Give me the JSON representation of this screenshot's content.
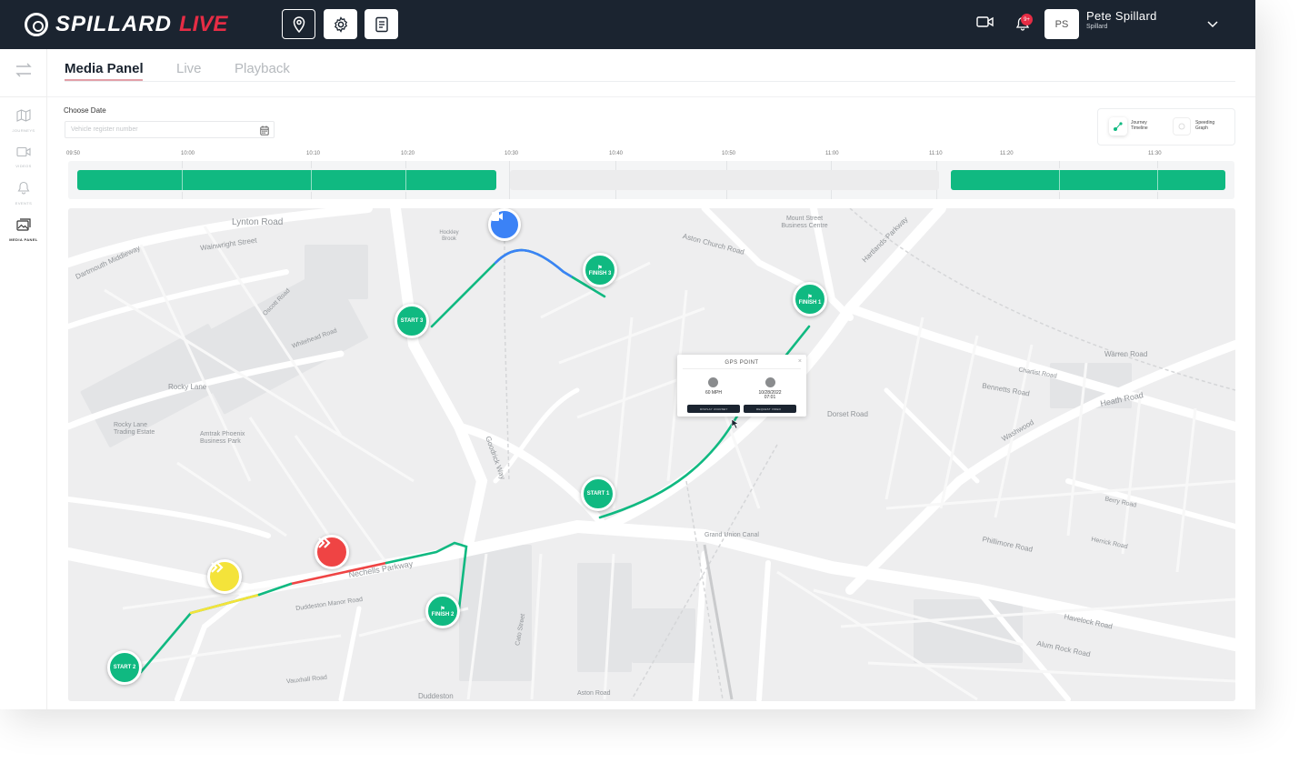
{
  "header": {
    "brand": "SPILLARD",
    "brand_live": "LIVE",
    "notification_count": "9+",
    "user_initials": "PS",
    "user_name": "Pete Spillard",
    "user_org": "Spillard"
  },
  "sidebar": {
    "items": [
      {
        "label": "JOURNEYS"
      },
      {
        "label": "VIDEOS"
      },
      {
        "label": "EVENTS"
      },
      {
        "label": "MEDIA PANEL"
      }
    ]
  },
  "tabs": [
    {
      "label": "Media Panel"
    },
    {
      "label": "Live"
    },
    {
      "label": "Playback"
    }
  ],
  "filters": {
    "choose_date_label": "Choose Date",
    "date_placeholder": "Vehicle register number",
    "toggle_journey": "Journey Timeline",
    "toggle_speeding": "Speeding Graph"
  },
  "timeline": {
    "ticks": [
      "09:50",
      "10:00",
      "10:10",
      "10:20",
      "10:30",
      "10:40",
      "10:50",
      "11:00",
      "11:10",
      "11:20",
      "11:30"
    ]
  },
  "map": {
    "markers": {
      "start1": "START 1",
      "start2": "START 2",
      "start3": "START 3",
      "finish1": "FINISH 1",
      "finish2": "FINISH 2",
      "finish3": "FINISH 3"
    },
    "streets": [
      "Lynton Road",
      "Wainwright Street",
      "Rocky Lane",
      "Nechells Parkway",
      "Aston Church Road",
      "Heath Road",
      "Dorset Road",
      "Warren Road",
      "Duddeston",
      "Goodrick Way",
      "Hartlands Parkway",
      "Washwood",
      "Phillimore Road",
      "Havelock Road",
      "Bennetts Road",
      "Alum Rock Road",
      "Mount Street Business Centre",
      "Grand Union Canal",
      "Amtrak Phoenix Business Park",
      "Rocky Lane Trading Estate",
      "Duddeston Manor Road",
      "Vauxhall Road",
      "Cato Street",
      "Chartist Road",
      "Berry Road",
      "Herrick Road",
      "Hockley Brook",
      "Aston Road",
      "Whitehead Road",
      "Dartmouth Middleway",
      "Oscott Road"
    ],
    "popup": {
      "title": "GPS POINT",
      "speed": "60 MPH",
      "date": "10/28/2022",
      "time": "07:01",
      "btn_journey": "DISPLAY JOURNEY",
      "btn_video": "REQUEST VIDEO"
    }
  },
  "colors": {
    "header_bg": "#1b2430",
    "accent_red": "#e62d45",
    "route_green": "#10b981",
    "route_blue": "#3b82f6",
    "marker_yellow": "#f4e33a",
    "marker_red": "#ef4444"
  }
}
